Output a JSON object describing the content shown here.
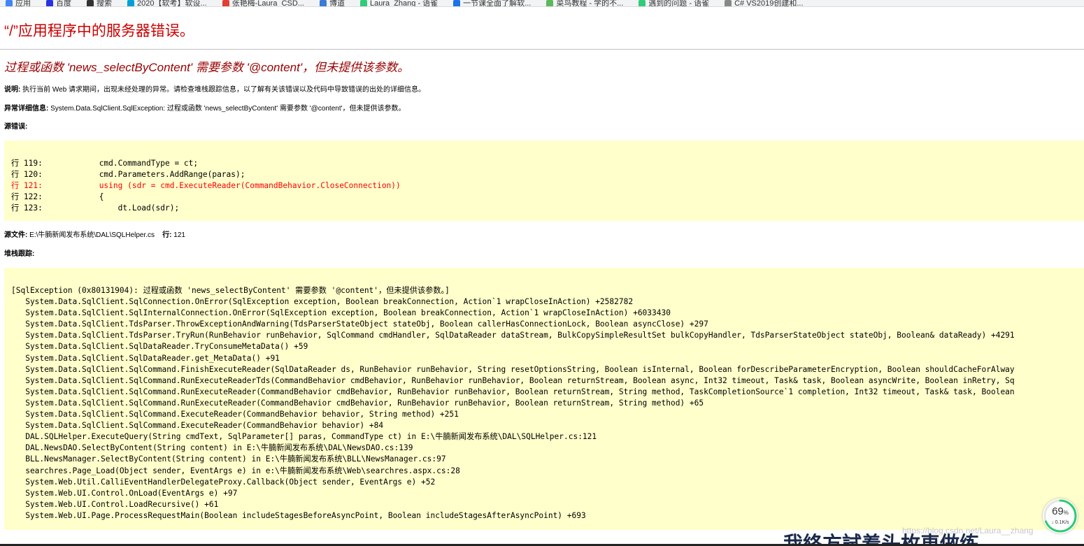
{
  "bookmarks": [
    {
      "label": "应用",
      "color": "#4285f4"
    },
    {
      "label": "百度",
      "color": "#2932e1"
    },
    {
      "label": "搜索",
      "color": "#333333"
    },
    {
      "label": "2020【软考】软设...",
      "color": "#00a1d6"
    },
    {
      "label": "张艳梅-Laura_CSD...",
      "color": "#e33e33"
    },
    {
      "label": "博道",
      "color": "#3a7bd5"
    },
    {
      "label": "Laura_Zhang - 语雀",
      "color": "#31cc79"
    },
    {
      "label": "一节课全面了解软...",
      "color": "#1a73e8"
    },
    {
      "label": "菜鸟教程 - 学的不...",
      "color": "#5cb85c"
    },
    {
      "label": "遇到的问题 - 语雀",
      "color": "#31cc79"
    },
    {
      "label": "C# VS2019创建和...",
      "color": "#888888"
    }
  ],
  "error": {
    "title": "“/”应用程序中的服务器错误。",
    "subtitle": "过程或函数 'news_selectByContent' 需要参数 '@content'，但未提供该参数。",
    "description_label": "说明:",
    "description": " 执行当前 Web 请求期间，出现未经处理的异常。请检查堆栈跟踪信息，以了解有关该错误以及代码中导致错误的出处的详细信息。",
    "exception_label": "异常详细信息:",
    "exception": " System.Data.SqlClient.SqlException: 过程或函数 'news_selectByContent' 需要参数 '@content'，但未提供该参数。",
    "source_error_label": "源错误:",
    "source_file_label": "源文件:",
    "source_file": " E:\\牛腩新闻发布系统\\DAL\\SQLHelper.cs",
    "line_label": "行:",
    "line_number": " 121",
    "stack_label": "堆栈跟踪:"
  },
  "source_lines": [
    "行 119:            cmd.CommandType = ct;",
    "行 120:            cmd.Parameters.AddRange(paras);",
    "行 121:            using (sdr = cmd.ExecuteReader(CommandBehavior.CloseConnection))",
    "行 122:            {",
    "行 123:                dt.Load(sdr);"
  ],
  "highlight_color": "#ff0000",
  "stack_lines": [
    "[SqlException (0x80131904): 过程或函数 'news_selectByContent' 需要参数 '@content'，但未提供该参数。]",
    "   System.Data.SqlClient.SqlConnection.OnError(SqlException exception, Boolean breakConnection, Action`1 wrapCloseInAction) +2582782",
    "   System.Data.SqlClient.SqlInternalConnection.OnError(SqlException exception, Boolean breakConnection, Action`1 wrapCloseInAction) +6033430",
    "   System.Data.SqlClient.TdsParser.ThrowExceptionAndWarning(TdsParserStateObject stateObj, Boolean callerHasConnectionLock, Boolean asyncClose) +297",
    "   System.Data.SqlClient.TdsParser.TryRun(RunBehavior runBehavior, SqlCommand cmdHandler, SqlDataReader dataStream, BulkCopySimpleResultSet bulkCopyHandler, TdsParserStateObject stateObj, Boolean& dataReady) +4291",
    "   System.Data.SqlClient.SqlDataReader.TryConsumeMetaData() +59",
    "   System.Data.SqlClient.SqlDataReader.get_MetaData() +91",
    "   System.Data.SqlClient.SqlCommand.FinishExecuteReader(SqlDataReader ds, RunBehavior runBehavior, String resetOptionsString, Boolean isInternal, Boolean forDescribeParameterEncryption, Boolean shouldCacheForAlway",
    "   System.Data.SqlClient.SqlCommand.RunExecuteReaderTds(CommandBehavior cmdBehavior, RunBehavior runBehavior, Boolean returnStream, Boolean async, Int32 timeout, Task& task, Boolean asyncWrite, Boolean inRetry, Sq",
    "   System.Data.SqlClient.SqlCommand.RunExecuteReader(CommandBehavior cmdBehavior, RunBehavior runBehavior, Boolean returnStream, String method, TaskCompletionSource`1 completion, Int32 timeout, Task& task, Boolean",
    "   System.Data.SqlClient.SqlCommand.RunExecuteReader(CommandBehavior cmdBehavior, RunBehavior runBehavior, Boolean returnStream, String method) +65",
    "   System.Data.SqlClient.SqlCommand.ExecuteReader(CommandBehavior behavior, String method) +251",
    "   System.Data.SqlClient.SqlCommand.ExecuteReader(CommandBehavior behavior) +84",
    "   DAL.SQLHelper.ExecuteQuery(String cmdText, SqlParameter[] paras, CommandType ct) in E:\\牛腩新闻发布系统\\DAL\\SQLHelper.cs:121",
    "   DAL.NewsDAO.SelectByContent(String content) in E:\\牛腩新闻发布系统\\DAL\\NewsDAO.cs:139",
    "   BLL.NewsManager.SelectByContent(String content) in E:\\牛腩新闻发布系统\\BLL\\NewsManager.cs:97",
    "   searchres.Page_Load(Object sender, EventArgs e) in e:\\牛腩新闻发布系统\\Web\\searchres.aspx.cs:28",
    "   System.Web.Util.CalliEventHandlerDelegateProxy.Callback(Object sender, EventArgs e) +52",
    "   System.Web.UI.Control.OnLoad(EventArgs e) +97",
    "   System.Web.UI.Control.LoadRecursive() +61",
    "   System.Web.UI.Page.ProcessRequestMain(Boolean includeStagesBeforeAsyncPoint, Boolean includeStagesAfterAsyncPoint) +693"
  ],
  "widget": {
    "percent": "69",
    "percent_unit": "%",
    "percent_value": 69,
    "speed": "↓ 0.1K/s",
    "ring_color": "#2ecc71"
  },
  "watermark": "https://blog.csdn.net/Laura__zhang",
  "bottom_text": "我終方試着头枚車做练"
}
